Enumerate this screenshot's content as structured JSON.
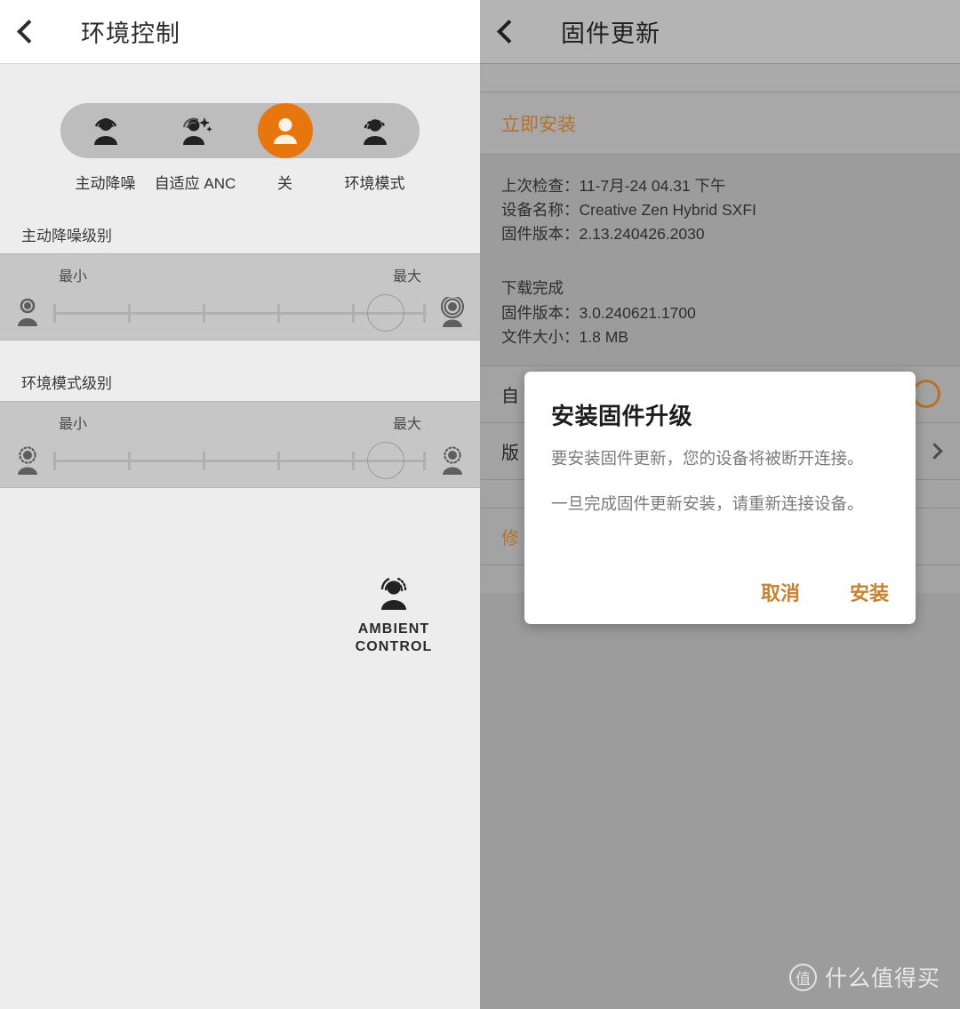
{
  "left": {
    "header": {
      "title": "环境控制",
      "back_icon": "back-chevron-icon"
    },
    "modes": [
      {
        "id": "anc",
        "label": "主动降噪",
        "icon": "anc-person-icon",
        "selected": false
      },
      {
        "id": "adaptive",
        "label": "自适应 ANC",
        "icon": "adaptive-anc-person-icon",
        "selected": false
      },
      {
        "id": "off",
        "label": "关",
        "icon": "off-person-icon",
        "selected": true
      },
      {
        "id": "ambient",
        "label": "环境模式",
        "icon": "ambient-person-icon",
        "selected": false
      }
    ],
    "anc_section": {
      "label": "主动降噪级别",
      "min_label": "最小",
      "max_label": "最大",
      "left_icon": "person-plain-icon",
      "right_icon": "person-waves-icon",
      "ticks": 6,
      "value_percent": 83
    },
    "ambient_section": {
      "label": "环境模式级别",
      "min_label": "最小",
      "max_label": "最大",
      "left_icon": "person-dotted-icon",
      "right_icon": "person-dotted-icon",
      "ticks": 6,
      "value_percent": 83
    },
    "logo": {
      "icon": "ambient-control-logo-icon",
      "line1": "AMBIENT",
      "line2": "CONTROL"
    }
  },
  "right": {
    "header": {
      "title": "固件更新",
      "back_icon": "back-chevron-icon"
    },
    "install_now_label": "立即安装",
    "info_current": [
      {
        "key": "上次检查：",
        "value": "11-7月-24 04.31 下午"
      },
      {
        "key": "设备名称：",
        "value": "Creative Zen Hybrid SXFI"
      },
      {
        "key": "固件版本：",
        "value": "2.13.240426.2030"
      }
    ],
    "download_status": "下载完成",
    "info_new": [
      {
        "key": "固件版本：",
        "value": "3.0.240621.1700"
      },
      {
        "key": "文件大小：",
        "value": "1.8 MB"
      }
    ],
    "rows": [
      {
        "id": "auto",
        "label": "自",
        "control": "toggle-ring",
        "accent": false
      },
      {
        "id": "version",
        "label": "版",
        "control": "chevron",
        "accent": false
      },
      {
        "id": "blank",
        "label": "",
        "control": "none",
        "accent": false
      },
      {
        "id": "repair",
        "label": "修",
        "control": "none",
        "accent": true
      }
    ]
  },
  "modal": {
    "title": "安装固件升级",
    "paragraph1": "要安装固件更新，您的设备将被断开连接。",
    "paragraph2": "一旦完成固件更新安装，请重新连接设备。",
    "cancel_label": "取消",
    "confirm_label": "安装"
  },
  "watermark": {
    "badge": "值",
    "text": "什么值得买"
  },
  "colors": {
    "accent_orange": "#e8760e",
    "accent_orange_dim": "#b5722a",
    "modal_button": "#c8812f",
    "left_bg": "#ededed",
    "right_bg": "#9c9c9c"
  }
}
